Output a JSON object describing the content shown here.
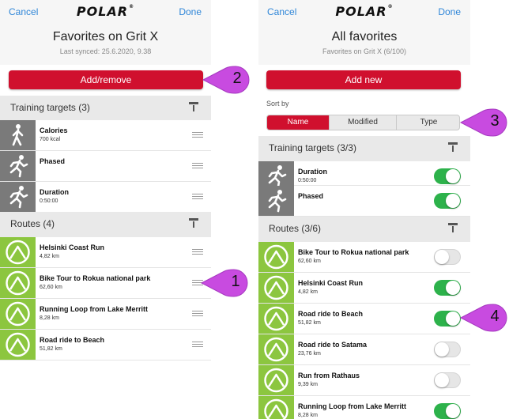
{
  "left": {
    "nav": {
      "cancel": "Cancel",
      "logo": "POLAR",
      "done": "Done"
    },
    "header": {
      "title": "Favorites on Grit X",
      "subtitle": "Last synced: 25.6.2020, 9.38"
    },
    "action_button": "Add/remove",
    "training_section": {
      "title": "Training targets (3)",
      "items": [
        {
          "name": "Calories",
          "sub": "700 kcal",
          "icon": "walking-person-icon"
        },
        {
          "name": "Phased",
          "sub": "",
          "icon": "running-person-icon"
        },
        {
          "name": "Duration",
          "sub": "0:50:00",
          "icon": "running-person-icon"
        }
      ]
    },
    "routes_section": {
      "title": "Routes (4)",
      "items": [
        {
          "name": "Helsinki Coast Run",
          "sub": "4,82 km",
          "icon": "route-icon"
        },
        {
          "name": "Bike Tour to Rokua national park",
          "sub": "62,60 km",
          "icon": "route-icon"
        },
        {
          "name": "Running Loop from Lake Merritt",
          "sub": "8,28 km",
          "icon": "route-icon"
        },
        {
          "name": "Road ride to Beach",
          "sub": "51,82 km",
          "icon": "route-icon"
        }
      ]
    }
  },
  "right": {
    "nav": {
      "cancel": "Cancel",
      "logo": "POLAR",
      "done": "Done"
    },
    "header": {
      "title": "All favorites",
      "subtitle": "Favorites on Grit X (6/100)"
    },
    "action_button": "Add new",
    "sort": {
      "label": "Sort by",
      "options": [
        "Name",
        "Modified",
        "Type"
      ],
      "selected": "Name"
    },
    "training_section": {
      "title": "Training targets (3/3)",
      "items": [
        {
          "name": "Duration",
          "sub": "0:50:00",
          "enabled": true,
          "icon": "running-person-icon"
        },
        {
          "name": "Phased",
          "sub": "",
          "enabled": true,
          "icon": "running-person-icon"
        }
      ]
    },
    "routes_section": {
      "title": "Routes (3/6)",
      "items": [
        {
          "name": "Bike Tour to Rokua national park",
          "sub": "62,60 km",
          "enabled": false,
          "icon": "route-icon"
        },
        {
          "name": "Helsinki Coast Run",
          "sub": "4,82 km",
          "enabled": true,
          "icon": "route-icon"
        },
        {
          "name": "Road ride to Beach",
          "sub": "51,82 km",
          "enabled": true,
          "icon": "route-icon"
        },
        {
          "name": "Road ride to Satama",
          "sub": "23,76 km",
          "enabled": false,
          "icon": "route-icon"
        },
        {
          "name": "Run from Rathaus",
          "sub": "9,39 km",
          "enabled": false,
          "icon": "route-icon"
        },
        {
          "name": "Running Loop from Lake Merritt",
          "sub": "8,28 km",
          "enabled": true,
          "icon": "route-icon"
        }
      ]
    }
  },
  "callouts": [
    "1",
    "2",
    "3",
    "4"
  ],
  "colors": {
    "brand_red": "#d0102e",
    "toggle_on": "#2db24b",
    "route_tile": "#8cc63f",
    "training_tile": "#7a7a7a",
    "callout": "#c84be0",
    "link": "#2f86d8"
  }
}
